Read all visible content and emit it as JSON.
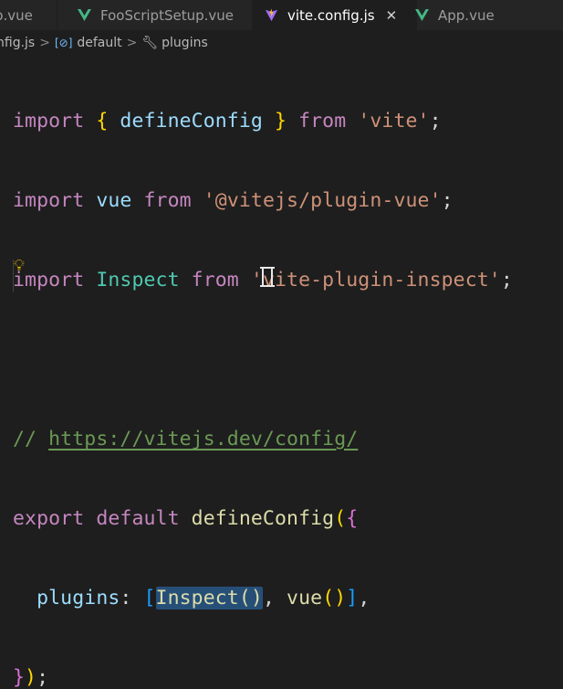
{
  "tabs": [
    {
      "label": "p.vue",
      "active": false
    },
    {
      "label": "FooScriptSetup.vue",
      "active": false
    },
    {
      "label": "vite.config.js",
      "active": true,
      "close": "✕"
    },
    {
      "label": "App.vue",
      "active": false
    }
  ],
  "breadcrumb": {
    "file": "nfig.js",
    "symbol": "default",
    "property": "plugins"
  },
  "code": {
    "l1": {
      "kw1": "import",
      "b1": "{",
      "name": "defineConfig",
      "b2": "}",
      "kw2": "from",
      "src": "'vite'",
      "semi": ";"
    },
    "l2": {
      "kw1": "import",
      "name": "vue",
      "kw2": "from",
      "src": "'@vitejs/plugin-vue'",
      "semi": ";"
    },
    "l3": {
      "kw1": "import",
      "name": "Inspect",
      "kw2": "from",
      "src": "'vite-plugin-inspect'",
      "semi": ";"
    },
    "l5": {
      "prefix": "// ",
      "url": "https://vitejs.dev/config/"
    },
    "l6": {
      "kw1": "export",
      "kw2": "default",
      "fn": "defineConfig",
      "p": "(",
      "b": "{"
    },
    "l7": {
      "prop": "plugins",
      "colon": ": ",
      "lb": "[",
      "sel": "Inspect()",
      "after": ", ",
      "vue": "vue",
      "vp": "()",
      "rb": "]",
      "comma": ","
    },
    "l8": {
      "b": "}",
      "p": ")",
      "semi": ";"
    }
  },
  "colors": {
    "keyword": "#c586c0",
    "variable": "#9cdcfe",
    "function": "#dcdcaa",
    "string": "#ce9178",
    "class": "#4ec9b0",
    "comment": "#6a9955",
    "selection": "#264f78",
    "vue_logo": "#42b883"
  }
}
